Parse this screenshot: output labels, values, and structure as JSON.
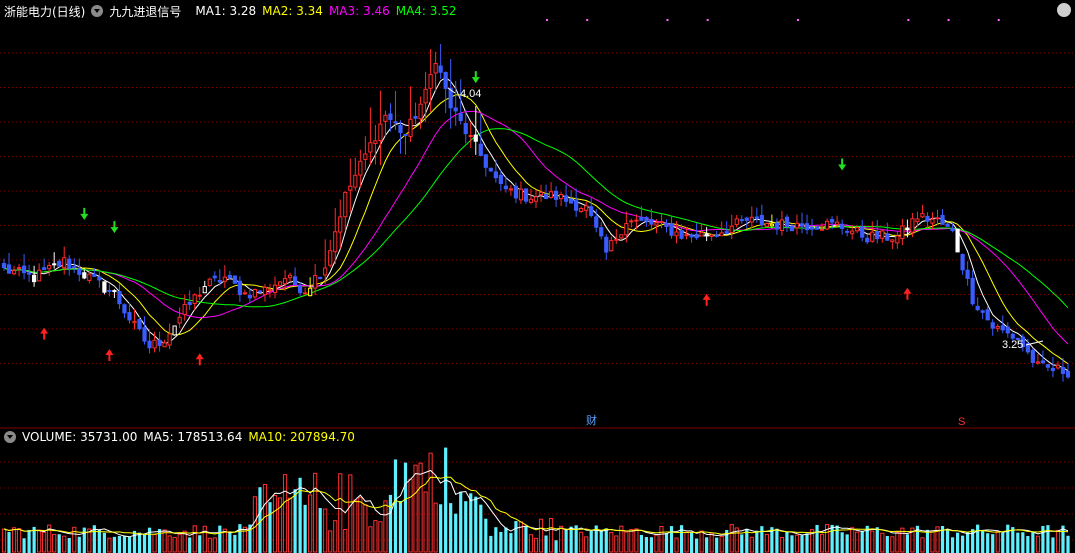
{
  "header": {
    "stock_name": "浙能电力(日线)",
    "indicator_name": "九九进退信号",
    "ma": [
      {
        "label": "MA1: 3.28",
        "color": "#ffffff"
      },
      {
        "label": "MA2: 3.34",
        "color": "#ffff00"
      },
      {
        "label": "MA3: 3.46",
        "color": "#ff00ff"
      },
      {
        "label": "MA4: 3.52",
        "color": "#00ff00"
      }
    ]
  },
  "volume_header": {
    "volume": "VOLUME: 35731.00",
    "ma5": "MA5: 178513.64",
    "ma10": "MA10: 207894.70"
  },
  "annotations": {
    "high_label": "4.04",
    "low_label": "3.25",
    "marker_cai": "财",
    "marker_s": "S"
  },
  "colors": {
    "up": "#ff2a2a",
    "down": "#3a5cff",
    "doji": "#ffffff",
    "ma1": "#ffffff",
    "ma2": "#ffff00",
    "ma3": "#ff00ff",
    "ma4": "#00ff00",
    "vol_down": "#5ff0ff",
    "vol_up": "#ff3030",
    "grid": "#800000"
  },
  "chart_data": {
    "type": "candlestick",
    "price_axis": {
      "min": 3.18,
      "max": 4.12
    },
    "price_path": [
      [
        0,
        3.52
      ],
      [
        6,
        3.5
      ],
      [
        12,
        3.54
      ],
      [
        17,
        3.5
      ],
      [
        22,
        3.46
      ],
      [
        26,
        3.38
      ],
      [
        29,
        3.33
      ],
      [
        32,
        3.35
      ],
      [
        36,
        3.42
      ],
      [
        40,
        3.48
      ],
      [
        44,
        3.5
      ],
      [
        48,
        3.46
      ],
      [
        52,
        3.47
      ],
      [
        56,
        3.5
      ],
      [
        60,
        3.47
      ],
      [
        64,
        3.53
      ],
      [
        68,
        3.7
      ],
      [
        72,
        3.8
      ],
      [
        76,
        3.9
      ],
      [
        80,
        3.85
      ],
      [
        84,
        3.95
      ],
      [
        86,
        4.04
      ],
      [
        89,
        3.92
      ],
      [
        92,
        3.86
      ],
      [
        95,
        3.8
      ],
      [
        99,
        3.72
      ],
      [
        104,
        3.7
      ],
      [
        110,
        3.7
      ],
      [
        116,
        3.67
      ],
      [
        120,
        3.56
      ],
      [
        124,
        3.64
      ],
      [
        130,
        3.63
      ],
      [
        136,
        3.6
      ],
      [
        142,
        3.61
      ],
      [
        148,
        3.64
      ],
      [
        154,
        3.63
      ],
      [
        160,
        3.63
      ],
      [
        166,
        3.63
      ],
      [
        172,
        3.6
      ],
      [
        178,
        3.6
      ],
      [
        182,
        3.65
      ],
      [
        186,
        3.64
      ],
      [
        189,
        3.61
      ],
      [
        193,
        3.45
      ],
      [
        197,
        3.38
      ],
      [
        202,
        3.35
      ],
      [
        206,
        3.28
      ],
      [
        212,
        3.27
      ]
    ],
    "trend_signals": {
      "up_arrow_days": [
        8,
        21,
        39,
        140,
        180
      ],
      "down_arrow_days": [
        16,
        22,
        94,
        167
      ],
      "special_candle_days": [
        6,
        10,
        16,
        20,
        22,
        34,
        40,
        61,
        94,
        140,
        153,
        180,
        190
      ]
    },
    "volume_axis": {
      "max": 220000
    },
    "volume_last": 35731
  }
}
